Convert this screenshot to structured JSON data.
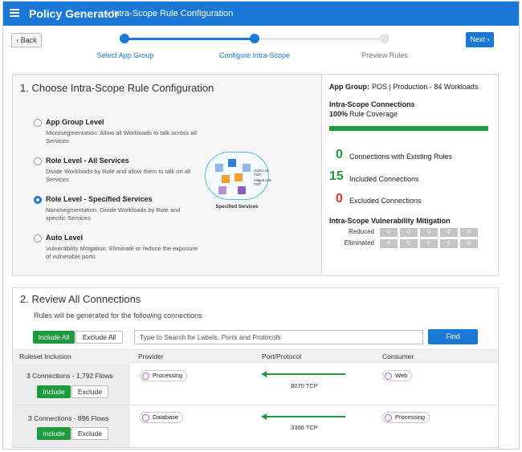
{
  "header": {
    "app_title": "Policy Generator",
    "page_title": "– Intra-Scope Rule Configuration"
  },
  "nav": {
    "back_label": "‹ Back",
    "next_label": "Next ›"
  },
  "stepper": [
    {
      "label": "Select App Group",
      "state": "complete"
    },
    {
      "label": "Configure Intra-Scope",
      "state": "current"
    },
    {
      "label": "Preview Rules",
      "state": "pending"
    }
  ],
  "section1": {
    "title": "1. Choose Intra-Scope Rule Configuration",
    "options": [
      {
        "title": "App Group Level",
        "desc": "Microsegmentation: Allow all Workloads to talk across all Services",
        "selected": false
      },
      {
        "title": "Role Level - All Services",
        "desc": "Divide Workloads by Role and allow them to talk on all Services",
        "selected": false
      },
      {
        "title": "Role Level - Specified Services",
        "desc": "Nanosegmentation: Divide Workloads by Role and specific Services",
        "selected": true
      },
      {
        "title": "Auto Level",
        "desc": "Vulnerability Mitigation: Eliminate or reduce the exposure of vulnerable ports",
        "selected": false
      }
    ],
    "diagram": {
      "caption": "Specified Services",
      "legend": [
        "redis1 22 TCP",
        "mllgpd eos TCP"
      ]
    }
  },
  "summary": {
    "app_group_label": "App Group:",
    "app_group_value": "POS | Production - 84 Workloads",
    "connections_title": "Intra-Scope Connections",
    "coverage_pct": "100%",
    "coverage_label": "Rule Coverage",
    "coverage_value": 1.0,
    "stats": [
      {
        "value": "0",
        "label": "Connections with Existing Rules",
        "color": "#1f9a3e"
      },
      {
        "value": "15",
        "label": "Included Connections",
        "color": "#1f9a3e"
      },
      {
        "value": "0",
        "label": "Excluded Connections",
        "color": "#d8362a"
      }
    ],
    "vuln_title": "Intra-Scope Vulnerability Mitigation",
    "vuln_rows": [
      {
        "label": "Reduced",
        "cells": [
          "0",
          "0",
          "0",
          "0",
          "0"
        ]
      },
      {
        "label": "Eliminated",
        "cells": [
          "0",
          "0",
          "0",
          "0",
          "0"
        ]
      }
    ]
  },
  "section2": {
    "title": "2. Review All Connections",
    "subtitle": "Rules will be generated for the following connections",
    "include_all": "Include All",
    "exclude_all": "Exclude All",
    "search_placeholder": "Type to Search for Labels, Ports and Protocols",
    "find_label": "Find",
    "columns": [
      "Ruleset Inclusion",
      "Provider",
      "Port/Protocol",
      "Consumer"
    ],
    "rows": [
      {
        "summary": "3 Connections - 1,792 Flows",
        "include": "Include",
        "exclude": "Exclude",
        "provider": "Processing",
        "port": "8070 TCP",
        "consumer": "Web"
      },
      {
        "summary": "3 Connections - 896 Flows",
        "include": "Include",
        "exclude": "Exclude",
        "provider": "Database",
        "port": "3306 TCP",
        "consumer": "Processing"
      }
    ]
  },
  "colors": {
    "brand_blue": "#1a78d6",
    "accent_green": "#1f9a3e",
    "alert_red": "#d8362a"
  }
}
